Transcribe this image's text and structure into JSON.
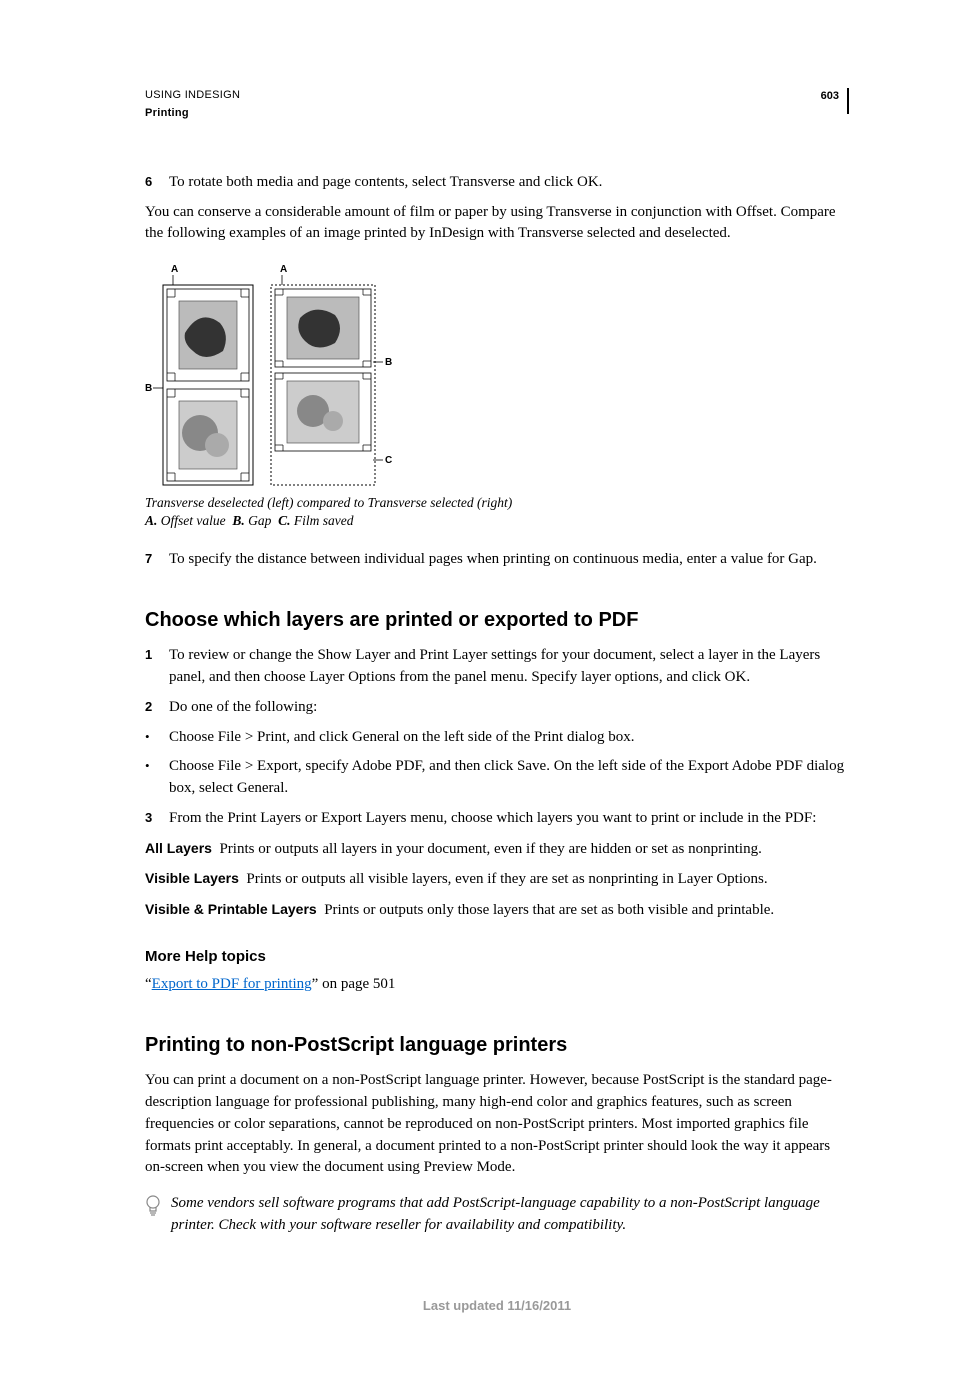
{
  "header": {
    "title": "USING INDESIGN",
    "subtitle": "Printing",
    "page": "603"
  },
  "step6": {
    "num": "6",
    "text": "To rotate both media and page contents, select Transverse and click OK."
  },
  "intro_p": "You can conserve a considerable amount of film or paper by using Transverse in conjunction with Offset. Compare the following examples of an image printed by InDesign with Transverse selected and deselected.",
  "figure": {
    "labelA": "A",
    "labelB": "B",
    "labelC": "C",
    "caption_line1": "Transverse deselected (left) compared to Transverse selected (right)",
    "caption_a_label": "A.",
    "caption_a_text": "Offset value",
    "caption_b_label": "B.",
    "caption_b_text": "Gap",
    "caption_c_label": "C.",
    "caption_c_text": "Film saved"
  },
  "step7": {
    "num": "7",
    "text": "To specify the distance between individual pages when printing on continuous media, enter a value for Gap."
  },
  "section1": {
    "heading": "Choose which layers are printed or exported to PDF",
    "step1_num": "1",
    "step1_text": "To review or change the Show Layer and Print Layer settings for your document, select a layer in the Layers panel, and then choose Layer Options from the panel menu. Specify layer options, and click OK.",
    "step2_num": "2",
    "step2_text": "Do one of the following:",
    "bullet1": "Choose File > Print, and click General on the left side of the Print dialog box.",
    "bullet2": "Choose File > Export, specify Adobe PDF, and then click Save. On the left side of the Export Adobe PDF dialog box, select General.",
    "step3_num": "3",
    "step3_text": "From the Print Layers or Export Layers menu, choose which layers you want to print or include in the PDF:",
    "def1_term": "All Layers",
    "def1_text": "Prints or outputs all layers in your document, even if they are hidden or set as nonprinting.",
    "def2_term": "Visible Layers",
    "def2_text": "Prints or outputs all visible layers, even if they are set as nonprinting in Layer Options.",
    "def3_term": "Visible & Printable Layers",
    "def3_text": "Prints or outputs only those layers that are set as both visible and printable.",
    "more_help": "More Help topics",
    "link_quote_open": "“",
    "link_text": "Export to PDF for printing",
    "link_suffix": "” on page 501"
  },
  "section2": {
    "heading": "Printing to non-PostScript language printers",
    "body": "You can print a document on a non-PostScript language printer. However, because PostScript is the standard page-description language for professional publishing, many high-end color and graphics features, such as screen frequencies or color separations, cannot be reproduced on non-PostScript printers. Most imported graphics file formats print acceptably. In general, a document printed to a non-PostScript printer should look the way it appears on-screen when you view the document using Preview Mode.",
    "tip": "Some vendors sell software programs that add PostScript-language capability to a non-PostScript language printer. Check with your software reseller for availability and compatibility."
  },
  "footer": "Last updated 11/16/2011"
}
